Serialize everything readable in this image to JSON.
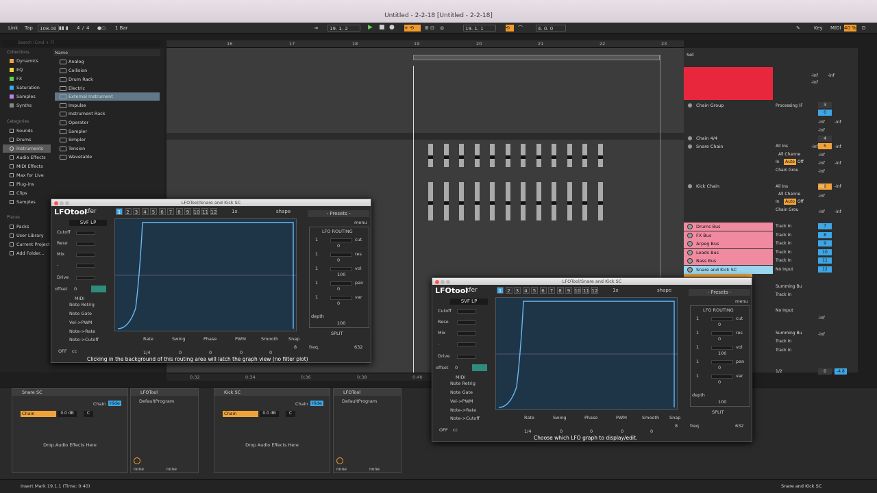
{
  "window": {
    "title": "Untitled - 2-2-18  [Untitled - 2-2-18]"
  },
  "transport": {
    "link": "Link",
    "tap": "Tap",
    "tempo": "108.00",
    "sig_num": "4",
    "sig_den": "4",
    "quant": "1 Bar",
    "position": "19.  1.  2",
    "loop_start": "19.  1.  1",
    "loop_len": "4.  0.  0",
    "key": "Key",
    "midi": "MIDI",
    "cpu": "40 %",
    "d": "D"
  },
  "browser": {
    "search_placeholder": "Search (Cmd + F)",
    "collections_label": "Collections",
    "collections": [
      {
        "label": "Dynamics",
        "color": "#f0a33a"
      },
      {
        "label": "EQ",
        "color": "#f0d23a"
      },
      {
        "label": "FX",
        "color": "#5dd34a"
      },
      {
        "label": "Saturation",
        "color": "#3ea7e6"
      },
      {
        "label": "Samples",
        "color": "#c27cf0"
      },
      {
        "label": "Synths",
        "color": "#888888"
      }
    ],
    "categories_label": "Categories",
    "categories": [
      "Sounds",
      "Drums",
      "Instruments",
      "Audio Effects",
      "MIDI Effects",
      "Max for Live",
      "Plug-ins",
      "Clips",
      "Samples"
    ],
    "places_label": "Places",
    "places": [
      "Packs",
      "User Library",
      "Current Project",
      "Add Folder..."
    ],
    "name_header": "Name",
    "files": [
      "Analog",
      "Collision",
      "Drum Rack",
      "Electric",
      "External Instrument",
      "Impulse",
      "Instrument Rack",
      "Operator",
      "Sampler",
      "Simpler",
      "Tension",
      "Wavetable"
    ]
  },
  "ruler": [
    "16",
    "17",
    "18",
    "19",
    "20",
    "21",
    "22",
    "23"
  ],
  "timeline": [
    "0:32",
    "0:34",
    "0:36",
    "0:38",
    "0:40"
  ],
  "mixer": {
    "set_label": "Set",
    "tracks": [
      {
        "name": "Chain Group",
        "color": "#e8d8d8",
        "io": "Processing (F",
        "num": "3"
      },
      {
        "name": "Chain 4/4",
        "color": "#2d2d2d",
        "io": "",
        "num": "4"
      },
      {
        "name": "Snare Chain",
        "color": "#2d2d2d",
        "io": "All Ins",
        "num": "5"
      },
      {
        "name": "Kick Chain",
        "color": "#2d2d2d",
        "io": "All Ins",
        "num": "6"
      },
      {
        "name": "Drums Bus",
        "color": "#f08aa0",
        "io": "Track In",
        "num": "7"
      },
      {
        "name": "FX Bus",
        "color": "#f08aa0",
        "io": "Track In",
        "num": "8"
      },
      {
        "name": "Arpeg Bus",
        "color": "#f08aa0",
        "io": "Track In",
        "num": "9"
      },
      {
        "name": "Leads Bus",
        "color": "#f08aa0",
        "io": "Track In",
        "num": "10"
      },
      {
        "name": "Bass Bus",
        "color": "#f08aa0",
        "io": "Track In",
        "num": "11"
      },
      {
        "name": "Snare and Kick SC",
        "color": "#9ad6f0",
        "io": "No Input",
        "num": "12"
      }
    ],
    "sub_labels": {
      "all_channels": "All Channe",
      "in": "In",
      "auto": "Auto",
      "off": "Off",
      "chain_group": "Chain Grou",
      "summing": "Summing Bu",
      "no_input": "No Input",
      "track_in": "Track In"
    },
    "inf": "-inf",
    "s": "S",
    "c": "C",
    "zero": "0",
    "bottom": {
      "ratio": "1/2",
      "num": "0",
      "val": "-4.8"
    }
  },
  "plugin1": {
    "title": "LFOTool/Snare and Kick SC",
    "logo": "LFOtool",
    "brand": "xfer",
    "tabs": [
      "1",
      "2",
      "3",
      "4",
      "5",
      "6",
      "7",
      "8",
      "9",
      "10",
      "11",
      "12"
    ],
    "zoom": "1x",
    "shape_label": "shape",
    "filter": "SVF LP",
    "params": [
      "Cutoff",
      "Reso",
      "Mix",
      "-",
      "Drive"
    ],
    "offset_label": "offset",
    "offset_val": "0",
    "midi_label": "MIDI",
    "midi_opts": [
      "Note Retrig",
      "Note Gate",
      "Vel->PWM",
      "Note->Rate",
      "Note->Cutoff"
    ],
    "off": "OFF",
    "cc": "cc",
    "bottom": [
      "Rate",
      "Swing",
      "Phase",
      "PWM",
      "Smooth",
      "Snap"
    ],
    "bottom_vals": [
      "1/4",
      "0",
      "0",
      "0",
      "0",
      "8"
    ],
    "presets": "- Presets -",
    "menu": "menu",
    "routing_label": "LFO ROUTING",
    "routes": [
      {
        "n": "1",
        "t": "cut",
        "v": "0"
      },
      {
        "n": "1",
        "t": "res",
        "v": "0"
      },
      {
        "n": "1",
        "t": "vol",
        "v": "100"
      },
      {
        "n": "1",
        "t": "pan",
        "v": "0"
      },
      {
        "n": "1",
        "t": "var",
        "v": "0"
      }
    ],
    "depth": "depth",
    "depth_val": "100",
    "split": "SPLIT",
    "freq": "freq.",
    "freq_val": "632",
    "hint": "Clicking in the background of this routing area will latch the graph view (no filter plot)"
  },
  "plugin2": {
    "title": "LFOTool/Snare and Kick SC",
    "hint": "Choose which LFO graph to display/edit."
  },
  "devices": {
    "snare": {
      "title": "Snare SC",
      "chain": "Chain",
      "hide": "Hide",
      "chain_row": "Chain",
      "db": "0.0 dB",
      "c": "C",
      "drop": "Drop Audio Effects Here"
    },
    "lfo_a": {
      "title": "LFOTool",
      "program": "DefaultProgram",
      "none1": "none",
      "none2": "none"
    },
    "kick": {
      "title": "Kick SC",
      "chain": "Chain",
      "hide": "Hide",
      "chain_row": "Chain",
      "db": "0.0 dB",
      "c": "C",
      "drop": "Drop Audio Effects Here"
    },
    "lfo_b": {
      "title": "LFOTool",
      "program": "DefaultProgram",
      "none1": "none",
      "none2": "none"
    }
  },
  "status": {
    "left": "Insert Mark 19.1.1 (Time: 0:40)",
    "right": "Snare and Kick SC"
  }
}
